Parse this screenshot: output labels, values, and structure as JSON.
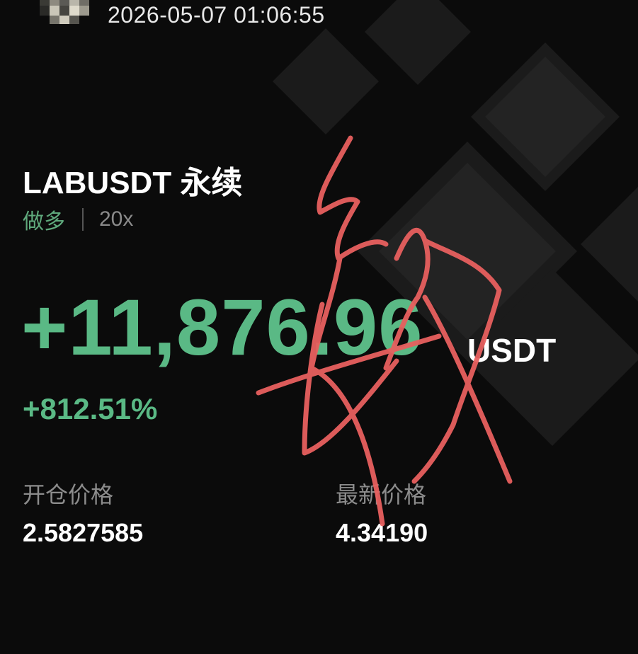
{
  "header": {
    "timestamp": "2026-05-07 01:06:55",
    "avatar_icon": "pixelated-avatar-icon"
  },
  "position": {
    "pair": "LABUSDT",
    "contract_type": "永续",
    "side": "做多",
    "leverage": "20x"
  },
  "pnl": {
    "value": "+11,876.96",
    "unit": "USDT",
    "roi": "+812.51%"
  },
  "prices": {
    "entry_label": "开仓价格",
    "entry_value": "2.5827585",
    "mark_label": "最新价格",
    "mark_value": "4.34190"
  },
  "colors": {
    "background": "#0b0b0b",
    "profit_green": "#5ab985",
    "side_green": "#5fa97c",
    "muted_text": "#8c8c8c",
    "scribble_red": "#e8605f"
  },
  "decorations": {
    "background_icon": "diamond-logo-pattern-icon",
    "overlay": "handwritten-signature-scribble"
  }
}
